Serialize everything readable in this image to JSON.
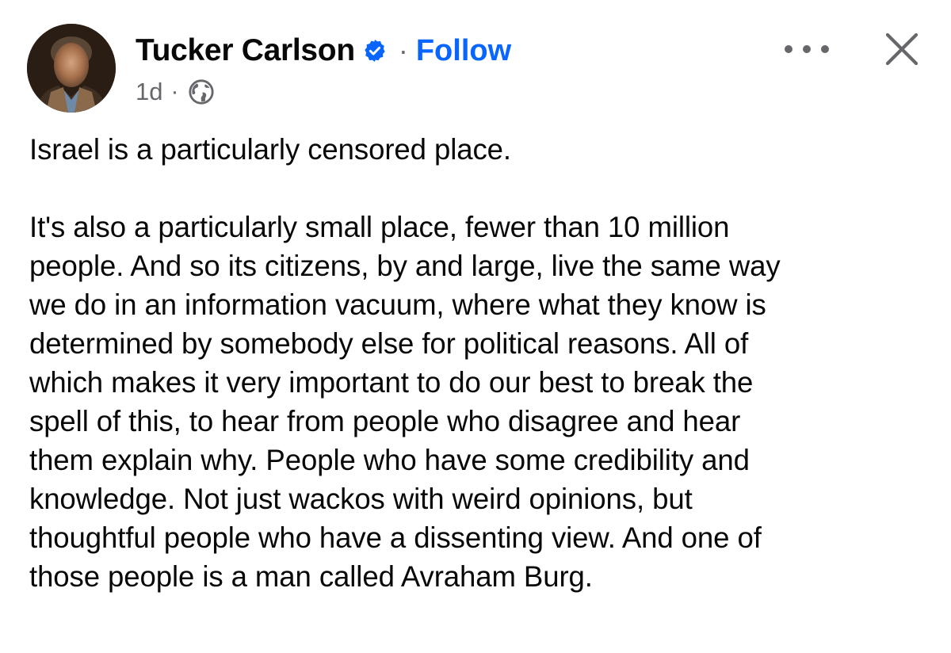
{
  "post": {
    "author": {
      "name": "Tucker Carlson",
      "verified": true,
      "avatar_icon": "profile-photo"
    },
    "separator": "·",
    "follow_label": "Follow",
    "timestamp": "1d",
    "audience_icon": "globe-icon",
    "more_icon": "more-options-icon",
    "close_icon": "close-icon",
    "paragraphs": [
      "Israel is a particularly censored place.",
      "It's also a particularly small place, fewer than 10 million\npeople. And so its citizens, by and large, live the same way\nwe do in an information vacuum, where what they know is\ndetermined by somebody else for political reasons. All of\nwhich makes it very important to do our best to break the\nspell of this, to hear from people who disagree and hear\nthem explain why. People who have some credibility and\nknowledge. Not just wackos with weird opinions, but\nthoughtful people who have a dissenting view. And one of\nthose people is a man called Avraham Burg."
    ]
  },
  "colors": {
    "text": "#080809",
    "secondary": "#65676b",
    "link_blue": "#0866ff",
    "verified_blue": "#0866ff"
  }
}
